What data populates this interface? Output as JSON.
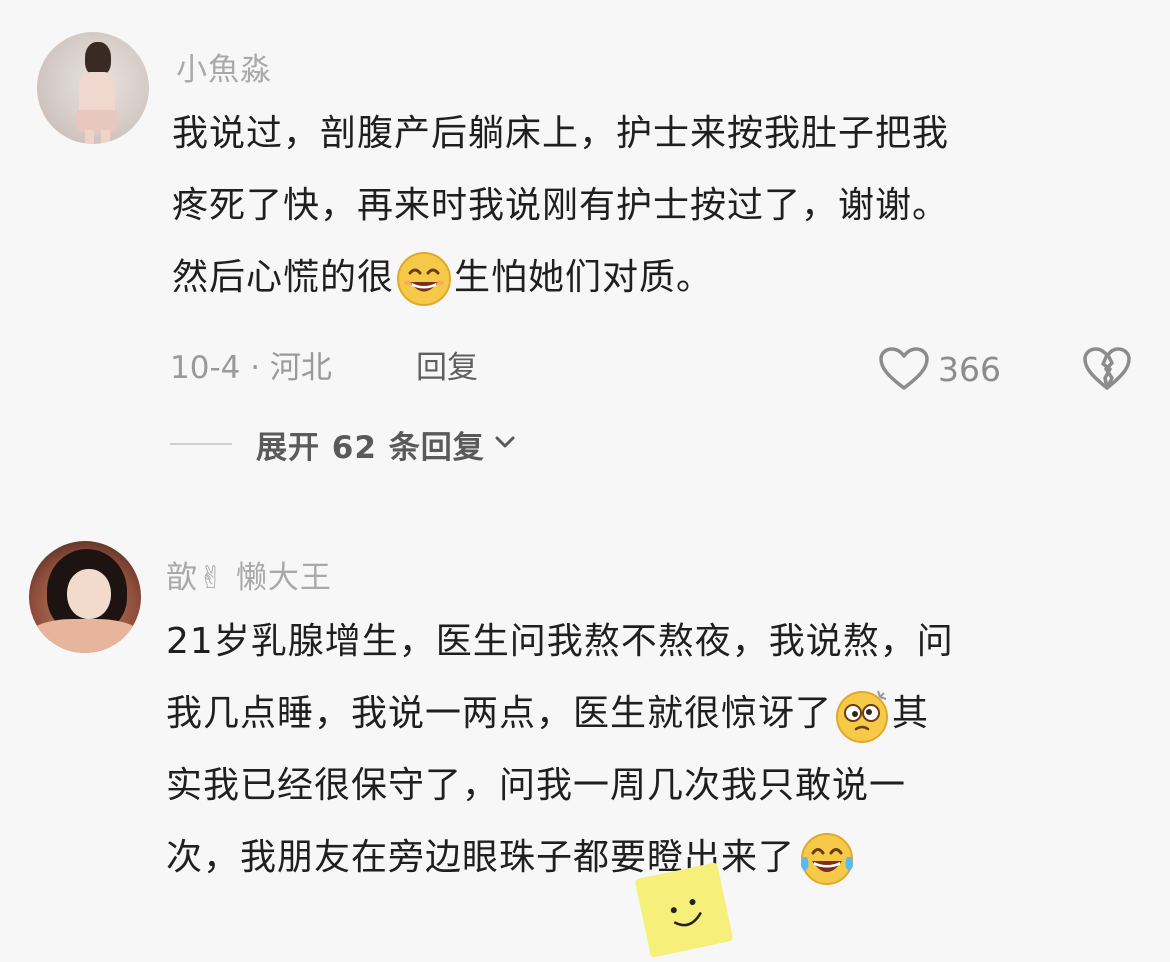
{
  "comments": [
    {
      "username": "小魚淼",
      "lines": [
        "我说过，剖腹产后躺床上，护士来按我肚子把我",
        "疼死了快，再来时我说刚有护士按过了，谢谢。"
      ],
      "line3_before": "然后心慌的很",
      "line3_after": "生怕她们对质。",
      "emoji": "grinning-face-emoji",
      "date_location": "10-4 · 河北",
      "reply_label": "回复",
      "likes": "366",
      "expand_label": "展开 62 条回复"
    },
    {
      "username": "歆✌ 懒大王",
      "line1": "21岁乳腺增生，医生问我熬不熬夜，我说熬，问",
      "line2_before": "我几点睡，我说一两点，医生就很惊讶了",
      "line2_after": "其",
      "line3": "实我已经很保守了，问我一周几次我只敢说一",
      "line4": "次，我朋友在旁边眼珠子都要瞪出来了",
      "emoji_mid": "dizzy-face-emoji",
      "emoji_end": "tears-of-joy-emoji"
    }
  ],
  "colors": {
    "background": "#f7f7f7",
    "username": "#a9a9a9",
    "body_text": "#1f1f1f",
    "meta": "#9a9a9a",
    "emoji_yellow": "#f7c948"
  }
}
